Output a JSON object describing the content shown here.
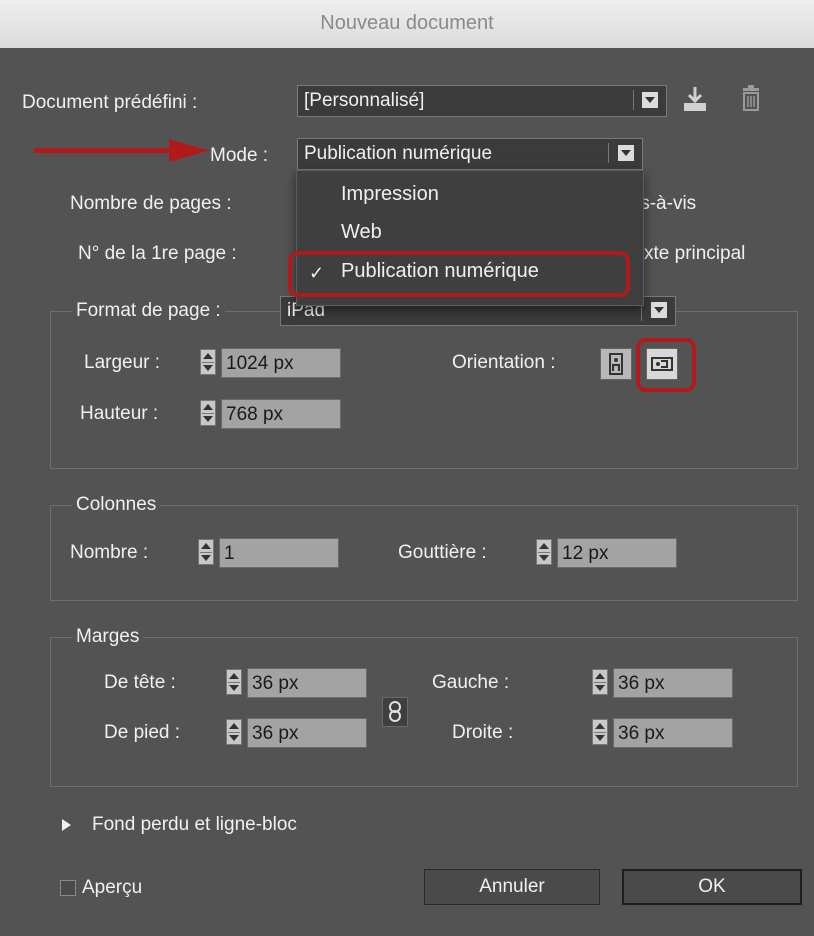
{
  "window": {
    "title": "Nouveau document"
  },
  "preset": {
    "label": "Document prédéfini :",
    "value": "[Personnalisé]"
  },
  "mode": {
    "label": "Mode :",
    "value": "Publication numérique",
    "options": [
      "Impression",
      "Web",
      "Publication numérique"
    ],
    "selected": "Publication numérique"
  },
  "pages": {
    "label": "Nombre de pages :",
    "facing_partial": "is-à-vis"
  },
  "start_page": {
    "label": "N° de la 1re page :",
    "primary_partial": "xte principal"
  },
  "page_format": {
    "label": "Format de page :",
    "value": "iPad",
    "width_label": "Largeur :",
    "width": "1024 px",
    "height_label": "Hauteur :",
    "height": "768 px",
    "orientation_label": "Orientation :"
  },
  "columns": {
    "legend": "Colonnes",
    "number_label": "Nombre :",
    "number": "1",
    "gutter_label": "Gouttière :",
    "gutter": "12 px"
  },
  "margins": {
    "legend": "Marges",
    "top_label": "De tête :",
    "top": "36 px",
    "bottom_label": "De pied :",
    "bottom": "36 px",
    "left_label": "Gauche :",
    "left": "36 px",
    "right_label": "Droite :",
    "right": "36 px"
  },
  "bleed": {
    "label": "Fond perdu et ligne-bloc"
  },
  "preview": {
    "label": "Aperçu"
  },
  "buttons": {
    "cancel": "Annuler",
    "ok": "OK"
  },
  "colors": {
    "highlight": "#b01a1a",
    "dialog_bg": "#535353"
  }
}
